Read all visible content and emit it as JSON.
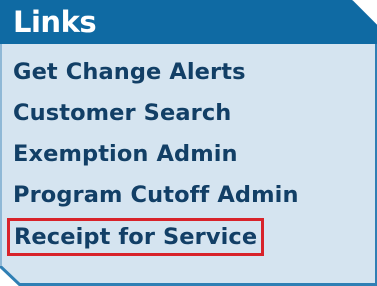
{
  "panel": {
    "title": "Links",
    "header_color": "#0f6aa3",
    "background_color": "#d5e4f0",
    "link_color": "#123f66",
    "highlight_color": "#d8232a"
  },
  "links": [
    {
      "label": "Get Change Alerts"
    },
    {
      "label": "Customer Search"
    },
    {
      "label": "Exemption Admin"
    },
    {
      "label": "Program Cutoff Admin"
    },
    {
      "label": "Receipt for Service",
      "highlighted": true
    }
  ]
}
